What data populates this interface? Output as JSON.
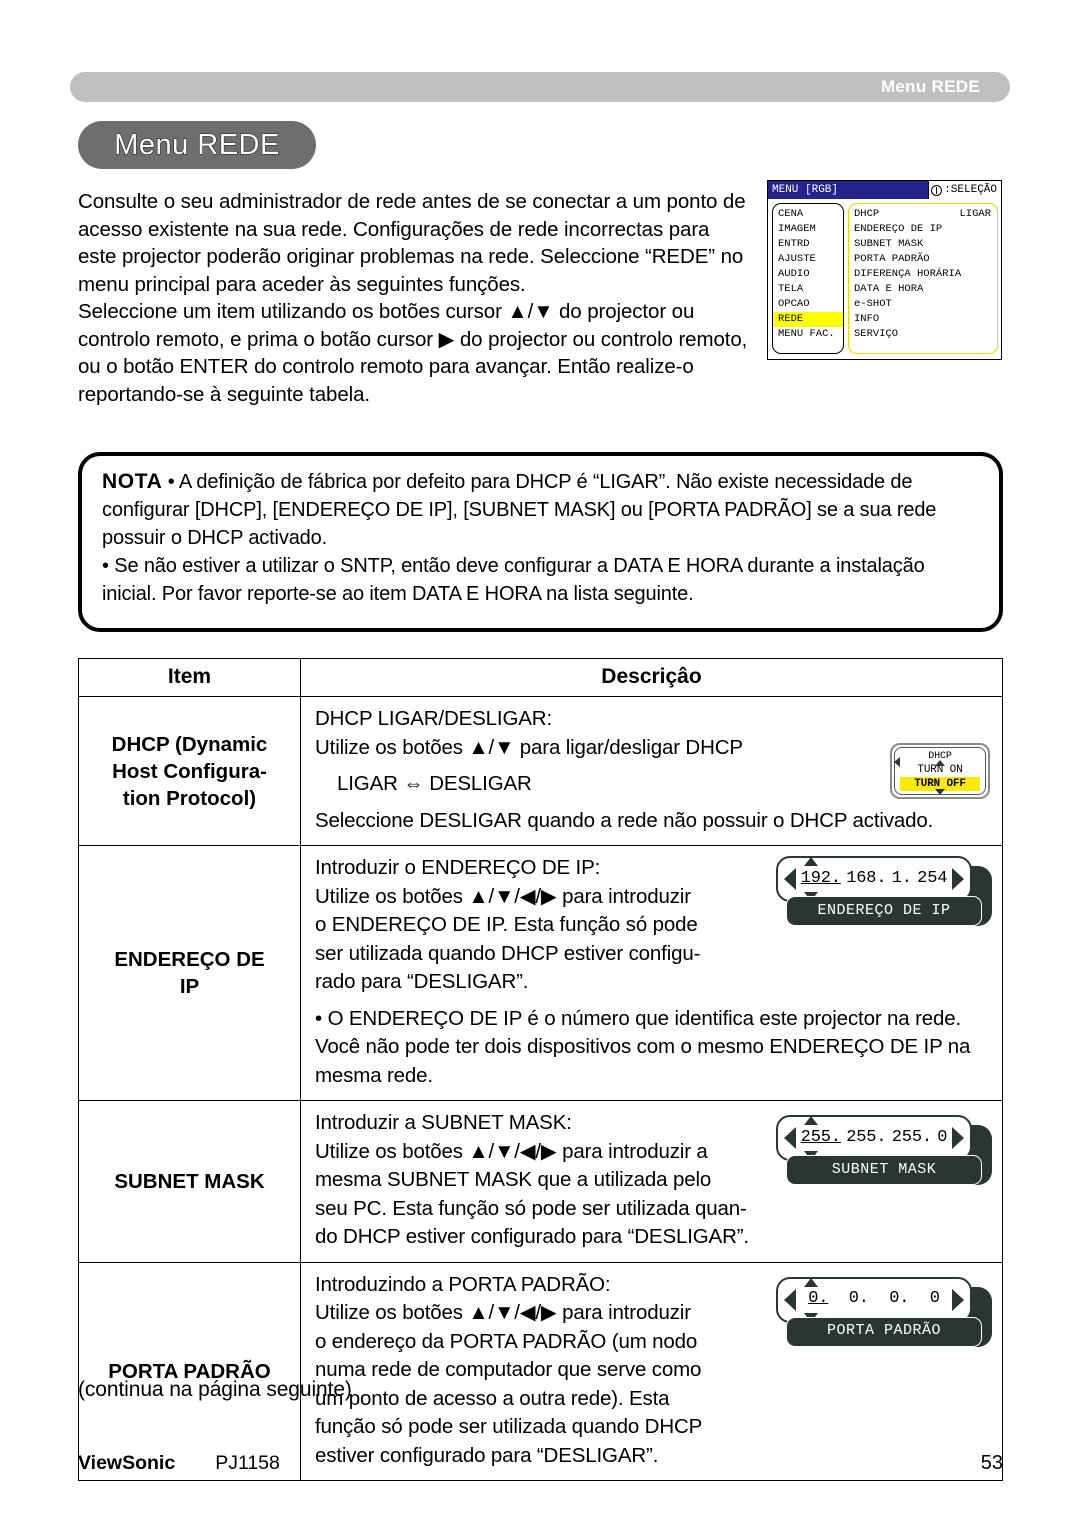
{
  "header": {
    "running_title": "Menu REDE"
  },
  "section": {
    "title": "Menu REDE"
  },
  "intro": {
    "paragraphs": [
      "Consulte o seu administrador de rede antes de se conectar a um ponto de acesso existente na sua rede. Configurações de rede incorrectas para este projector poderão originar problemas na rede. Seleccione “REDE” no menu principal para aceder às seguintes funções.",
      "Seleccione um item utilizando os botões cursor ▲/▼ do projector ou controlo remoto, e prima o botão cursor ▶ do projector ou controlo remoto, ou o botão ENTER do controlo remoto para avançar. Então realize-o reportando-se à seguinte tabela."
    ]
  },
  "osd_capture": {
    "menu_label": "MENU [RGB]",
    "selection_label": ":SELEÇÃO",
    "left_items": [
      "CENA",
      "IMAGEM",
      "ENTRD",
      "AJUSTE",
      "AUDIO",
      "TELA",
      "OPCAO",
      "REDE",
      "MENU FAC."
    ],
    "left_highlight_index": 7,
    "right_items": [
      {
        "label": "DHCP",
        "value": "LIGAR"
      },
      {
        "label": "ENDEREÇO DE IP",
        "value": ""
      },
      {
        "label": "SUBNET MASK",
        "value": ""
      },
      {
        "label": "PORTA PADRÃO",
        "value": ""
      },
      {
        "label": "DIFERENÇA HORÁRIA",
        "value": ""
      },
      {
        "label": "DATA E HORA",
        "value": ""
      },
      {
        "label": "e-SHOT",
        "value": ""
      },
      {
        "label": "INFO",
        "value": ""
      },
      {
        "label": "SERVIÇO",
        "value": ""
      }
    ],
    "colors": {
      "titlebar": "#24248c",
      "highlight": "#ffff00",
      "right_border": "#e8d800"
    }
  },
  "nota": {
    "label": "NOTA",
    "lines": [
      "• A definição de fábrica por defeito para DHCP é “LIGAR”. Não existe necessidade de configurar [DHCP], [ENDEREÇO DE IP], [SUBNET MASK] ou [PORTA PADRÃO] se a sua rede possuir o DHCP activado.",
      "• Se não estiver a utilizar o SNTP, então deve configurar a DATA E HORA durante a instalação inicial. Por favor reporte-se ao item DATA E HORA na lista seguinte."
    ]
  },
  "table": {
    "headers": {
      "item": "Item",
      "description": "Descriçâo"
    },
    "rows": [
      {
        "item": "DHCP (Dynamic Host Configura-\ntion Protocol)",
        "item_lines": [
          "DHCP (Dynamic",
          "Host Configura-",
          "tion Protocol)"
        ],
        "desc_lines": [
          "DHCP LIGAR/DESLIGAR:",
          "Utilize os botões ▲/▼ para ligar/desligar DHCP"
        ],
        "desc_toggle": "LIGAR ⇔ DESLIGAR",
        "desc_footer": "Seleccione DESLIGAR quando a rede não possuir o DHCP activado.",
        "widget": {
          "kind": "toggle",
          "title": "DHCP",
          "option_on": "TURN ON",
          "option_off": "TURN OFF",
          "selected": "TURN OFF",
          "highlight_color": "#ffeb00"
        }
      },
      {
        "item": "ENDEREÇO DE IP",
        "item_lines": [
          "ENDEREÇO DE",
          "IP"
        ],
        "desc_lines": [
          "Introduzir o ENDEREÇO DE IP:",
          "Utilize os botões ▲/▼/◀/▶ para introduzir",
          "o ENDEREÇO DE IP. Esta função só pode",
          "ser utilizada quando DHCP estiver configu-",
          "rado para “DESLIGAR”."
        ],
        "desc_bullet": "• O ENDEREÇO DE IP é o número que identifica este projector na rede. Você não pode ter dois dispositivos com o mesmo ENDEREÇO DE IP na mesma rede.",
        "widget": {
          "kind": "octets",
          "label": "ENDEREÇO DE IP",
          "octets": [
            "192.",
            "168.",
            "1.",
            "254"
          ],
          "selected_index": 0
        }
      },
      {
        "item": "SUBNET MASK",
        "item_lines": [
          "SUBNET MASK"
        ],
        "desc_lines": [
          "Introduzir a SUBNET MASK:",
          "Utilize os botões ▲/▼/◀/▶ para introduzir a",
          "mesma SUBNET MASK que a utilizada pelo",
          "seu PC. Esta função só pode ser utilizada quan-",
          "do DHCP estiver configurado para “DESLIGAR”."
        ],
        "widget": {
          "kind": "octets",
          "label": "SUBNET MASK",
          "octets": [
            "255.",
            "255.",
            "255.",
            "0"
          ],
          "selected_index": 0
        }
      },
      {
        "item": "PORTA PADRÃO",
        "item_lines": [
          "PORTA PADRÃO"
        ],
        "desc_lines": [
          "Introduzindo a PORTA PADRÃO:",
          "Utilize os botões ▲/▼/◀/▶ para introduzir",
          "o endereço da PORTA PADRÃO (um nodo",
          "numa rede de computador que serve como",
          "um ponto de acesso a outra rede). Esta",
          "função só pode ser utilizada quando DHCP",
          "estiver configurado para “DESLIGAR”."
        ],
        "widget": {
          "kind": "octets",
          "label": "PORTA PADRÃO",
          "octets": [
            "0.",
            "0.",
            "0.",
            "0"
          ],
          "selected_index": 0
        }
      }
    ]
  },
  "continued_note": "(continua na página seguinte)",
  "footer": {
    "brand": "ViewSonic",
    "model": "PJ1158",
    "page_number": "53"
  }
}
